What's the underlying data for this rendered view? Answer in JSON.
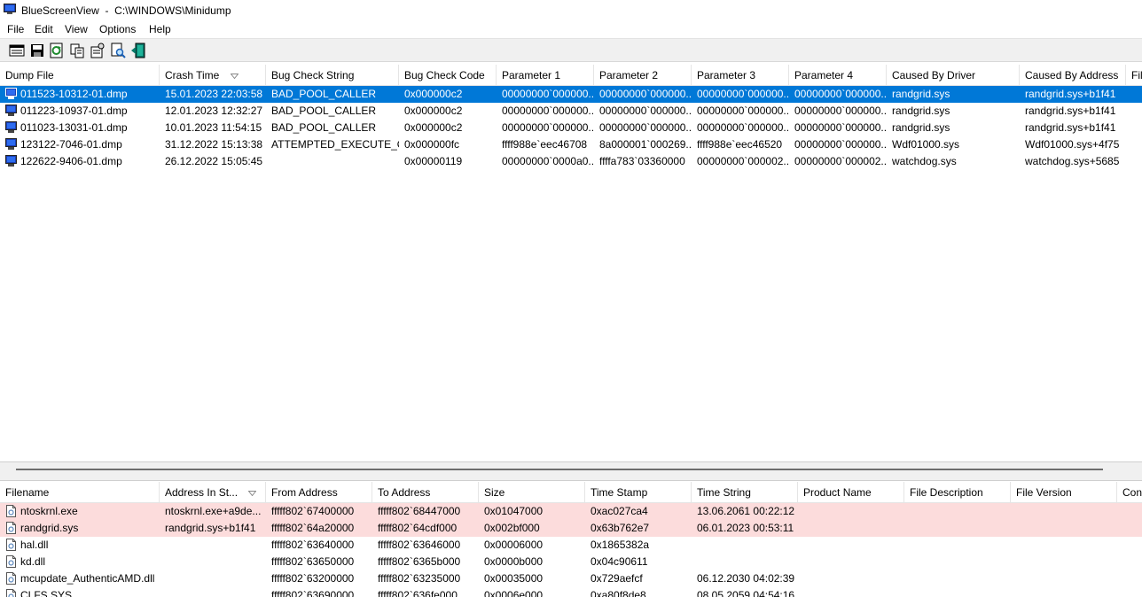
{
  "window": {
    "title": "BlueScreenView  -  C:\\WINDOWS\\Minidump",
    "app_icon": "bluescreen-app-icon"
  },
  "menu": [
    "File",
    "Edit",
    "View",
    "Options",
    "Help"
  ],
  "toolbar": [
    "properties-window-icon",
    "save-icon",
    "refresh-icon",
    "copy-icon",
    "properties-icon",
    "find-icon",
    "exit-icon"
  ],
  "top_table": {
    "columns": [
      "Dump File",
      "Crash Time",
      "Bug Check String",
      "Bug Check Code",
      "Parameter 1",
      "Parameter 2",
      "Parameter 3",
      "Parameter 4",
      "Caused By Driver",
      "Caused By Address",
      "Fil"
    ],
    "sorted_column": "Crash Time",
    "rows": [
      [
        "011523-10312-01.dmp",
        "15.01.2023 22:03:58",
        "BAD_POOL_CALLER",
        "0x000000c2",
        "00000000`000000...",
        "00000000`000000...",
        "00000000`000000...",
        "00000000`000000...",
        "randgrid.sys",
        "randgrid.sys+b1f41",
        ""
      ],
      [
        "011223-10937-01.dmp",
        "12.01.2023 12:32:27",
        "BAD_POOL_CALLER",
        "0x000000c2",
        "00000000`000000...",
        "00000000`000000...",
        "00000000`000000...",
        "00000000`000000...",
        "randgrid.sys",
        "randgrid.sys+b1f41",
        ""
      ],
      [
        "011023-13031-01.dmp",
        "10.01.2023 11:54:15",
        "BAD_POOL_CALLER",
        "0x000000c2",
        "00000000`000000...",
        "00000000`000000...",
        "00000000`000000...",
        "00000000`000000...",
        "randgrid.sys",
        "randgrid.sys+b1f41",
        ""
      ],
      [
        "123122-7046-01.dmp",
        "31.12.2022 15:13:38",
        "ATTEMPTED_EXECUTE_O...",
        "0x000000fc",
        "ffff988e`eec46708",
        "8a000001`000269...",
        "ffff988e`eec46520",
        "00000000`000000...",
        "Wdf01000.sys",
        "Wdf01000.sys+4f75",
        ""
      ],
      [
        "122622-9406-01.dmp",
        "26.12.2022 15:05:45",
        "",
        "0x00000119",
        "00000000`0000a0...",
        "ffffa783`03360000",
        "00000000`000002...",
        "00000000`000002...",
        "watchdog.sys",
        "watchdog.sys+5685",
        ""
      ]
    ],
    "selected_row": 0
  },
  "bottom_table": {
    "columns": [
      "Filename",
      "Address In St...",
      "From Address",
      "To Address",
      "Size",
      "Time Stamp",
      "Time String",
      "Product Name",
      "File Description",
      "File Version",
      "Con"
    ],
    "sorted_column": "Address In St...",
    "rows": [
      [
        "ntoskrnl.exe",
        "ntoskrnl.exe+a9de...",
        "fffff802`67400000",
        "fffff802`68447000",
        "0x01047000",
        "0xac027ca4",
        "13.06.2061 00:22:12",
        "",
        "",
        "",
        ""
      ],
      [
        "randgrid.sys",
        "randgrid.sys+b1f41",
        "fffff802`64a20000",
        "fffff802`64cdf000",
        "0x002bf000",
        "0x63b762e7",
        "06.01.2023 00:53:11",
        "",
        "",
        "",
        ""
      ],
      [
        "hal.dll",
        "",
        "fffff802`63640000",
        "fffff802`63646000",
        "0x00006000",
        "0x1865382a",
        "",
        "",
        "",
        "",
        ""
      ],
      [
        "kd.dll",
        "",
        "fffff802`63650000",
        "fffff802`6365b000",
        "0x0000b000",
        "0x04c90611",
        "",
        "",
        "",
        "",
        ""
      ],
      [
        "mcupdate_AuthenticAMD.dll",
        "",
        "fffff802`63200000",
        "fffff802`63235000",
        "0x00035000",
        "0x729aefcf",
        "06.12.2030 04:02:39",
        "",
        "",
        "",
        ""
      ],
      [
        "CLFS.SYS",
        "",
        "fffff802`63690000",
        "fffff802`636fe000",
        "0x0006e000",
        "0xa80f8de8",
        "08.05.2059 04:54:16",
        "",
        "",
        "",
        ""
      ]
    ],
    "highlighted_rows": [
      0,
      1
    ]
  },
  "colors": {
    "selection": "#0078d7",
    "highlight_row": "#fcdcdc",
    "toolbar_bg": "#f0f0f0"
  }
}
